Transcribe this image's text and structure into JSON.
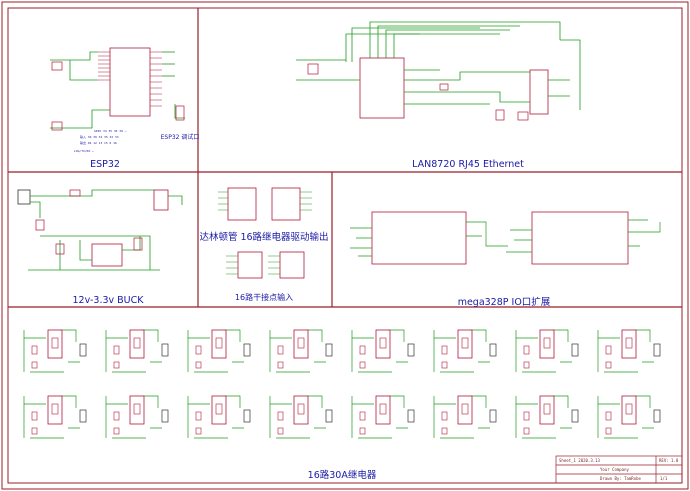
{
  "sections": {
    "esp32": "ESP32",
    "lan": "LAN8720 RJ45 Ethernet",
    "buck": "12v-3.3v BUCK",
    "relay_driver": "达林顿管 16路继电器驱动输出",
    "dry_input": "16路干接点输入",
    "mega": "mega328P IO口扩展",
    "relays": "16路30A继电器"
  },
  "chips": {
    "esp32_debug": "ESP32 调试口"
  },
  "title_block": {
    "sheet": "Sheet_1",
    "date": "2020.3.13",
    "rev": "REV: 1.0",
    "company": "Your Company",
    "drawn": "Drawn By: TamRobe",
    "page": "1/1"
  },
  "colors": {
    "frame": "#9a1f2a",
    "wire": "#1e9a1e",
    "part": "#b0193a",
    "text": "#1a1aa6"
  }
}
